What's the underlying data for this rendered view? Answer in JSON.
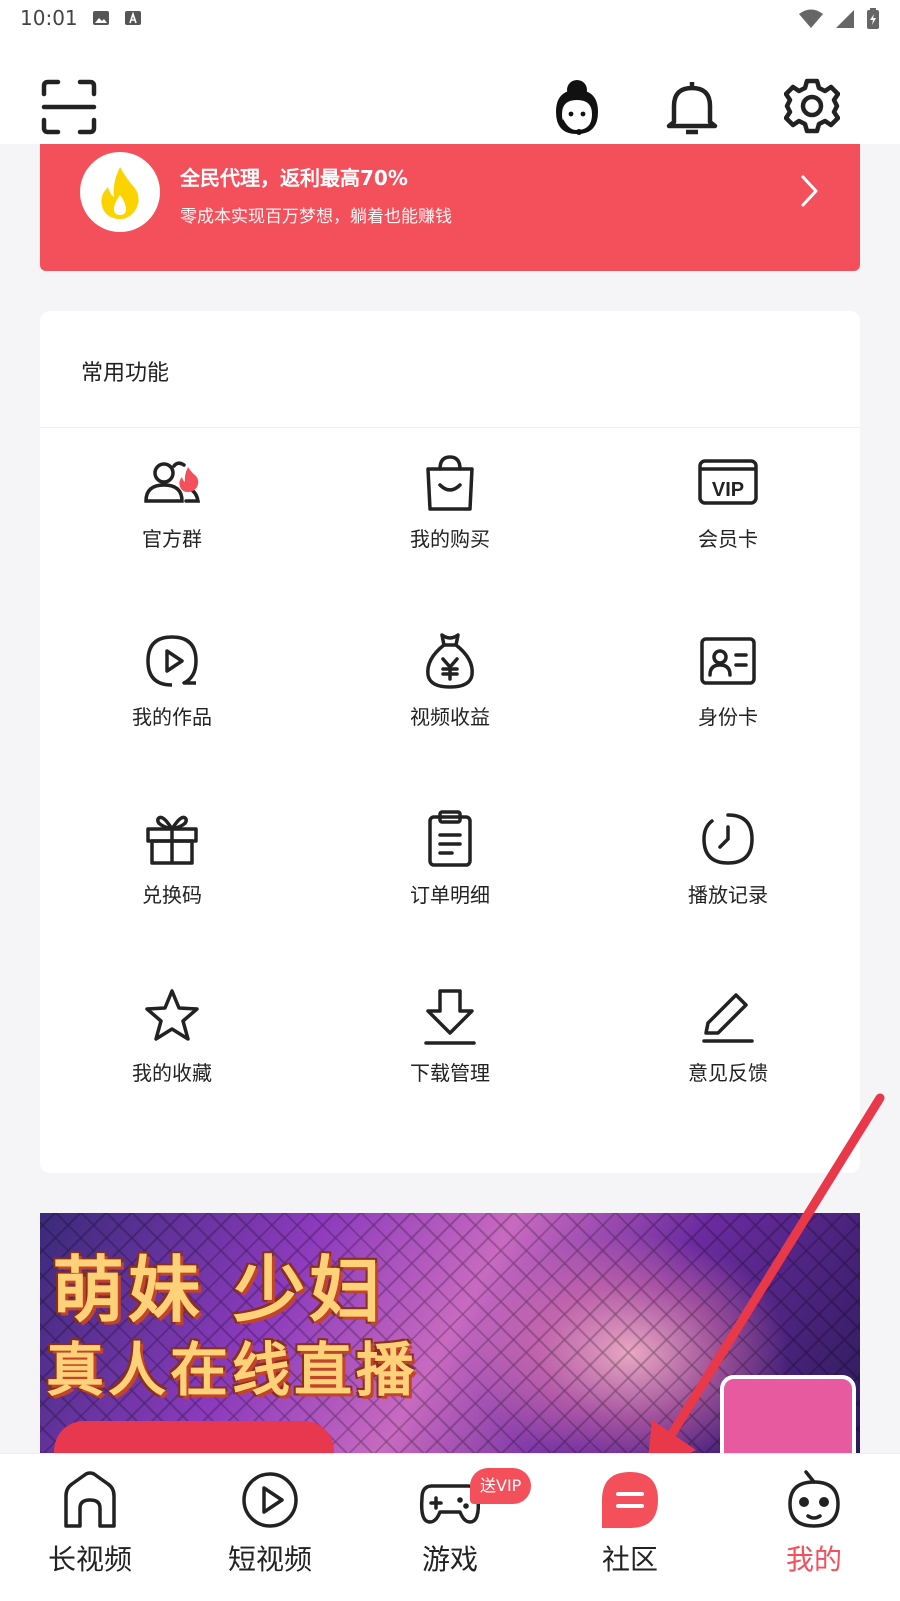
{
  "status_bar": {
    "time": "10:01"
  },
  "promo": {
    "title": "全民代理，返利最高70%",
    "subtitle": "零成本实现百万梦想，躺着也能赚钱"
  },
  "functions": {
    "title": "常用功能",
    "items": [
      {
        "label": "官方群",
        "icon": "group-fire-icon"
      },
      {
        "label": "我的购买",
        "icon": "shopping-bag-icon"
      },
      {
        "label": "会员卡",
        "icon": "vip-card-icon"
      },
      {
        "label": "我的作品",
        "icon": "play-circle-icon"
      },
      {
        "label": "视频收益",
        "icon": "money-bag-icon"
      },
      {
        "label": "身份卡",
        "icon": "id-card-icon"
      },
      {
        "label": "兑换码",
        "icon": "gift-icon"
      },
      {
        "label": "订单明细",
        "icon": "clipboard-icon"
      },
      {
        "label": "播放记录",
        "icon": "clock-icon"
      },
      {
        "label": "我的收藏",
        "icon": "star-icon"
      },
      {
        "label": "下载管理",
        "icon": "download-icon"
      },
      {
        "label": "意见反馈",
        "icon": "edit-icon"
      }
    ]
  },
  "ad": {
    "line1": "萌妹 少妇",
    "line2": "真人在线直播"
  },
  "bottom_nav": {
    "items": [
      {
        "label": "长视频",
        "icon": "home-icon"
      },
      {
        "label": "短视频",
        "icon": "play-icon"
      },
      {
        "label": "游戏",
        "icon": "gamepad-icon"
      },
      {
        "label": "社区",
        "icon": "community-icon"
      },
      {
        "label": "我的",
        "icon": "profile-icon"
      }
    ],
    "vip_badge": "送VIP",
    "active_index": 4
  },
  "colors": {
    "accent": "#f4505c",
    "background": "#f5f5f7"
  }
}
